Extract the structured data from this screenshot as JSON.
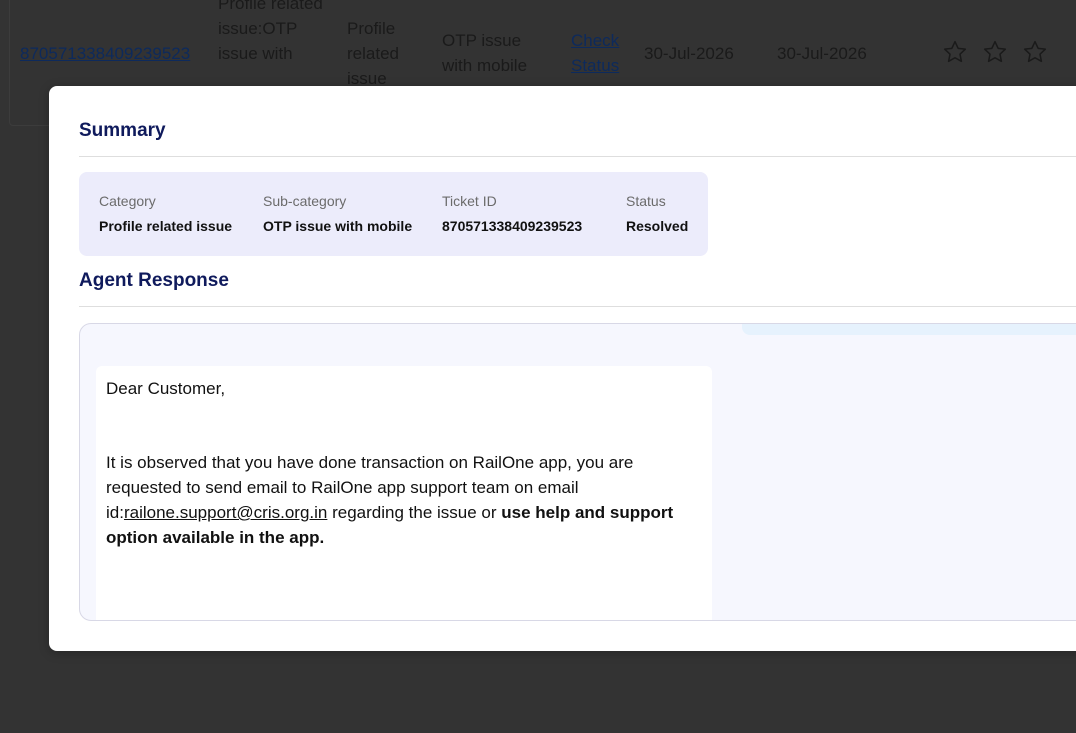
{
  "table_row": {
    "ticket_id": "870571338409239523",
    "description": "Profile related issue:OTP issue with",
    "category": "Profile related issue",
    "sub_category": "OTP issue with mobile",
    "check_status": "Check Status",
    "created_date": "30-Jul-2026",
    "updated_date": "30-Jul-2026",
    "rating_stars": 3,
    "rating_value": 0,
    "star_icon": "star-outline-icon"
  },
  "modal": {
    "summary_title": "Summary",
    "summary": {
      "category_label": "Category",
      "category_value": "Profile related issue",
      "subcategory_label": "Sub-category",
      "subcategory_value": "OTP issue with mobile",
      "ticket_id_label": "Ticket ID",
      "ticket_id_value": "870571338409239523",
      "status_label": "Status",
      "status_value": "Resolved"
    },
    "agent_response_title": "Agent Response",
    "message": {
      "greeting": "Dear Customer,",
      "body_part1": "It is observed that you have done transaction on RailOne app, you are requested to send email to RailOne app support team on email id:",
      "email": "railone.support@cris.org.in",
      "body_part2": " regarding the issue or ",
      "body_bold": "use help and support option available in the app."
    }
  },
  "colors": {
    "backdrop": "#333333",
    "title": "#0f1a5c",
    "summary_bg": "#ececfb",
    "response_bg": "#f6f7fe"
  }
}
